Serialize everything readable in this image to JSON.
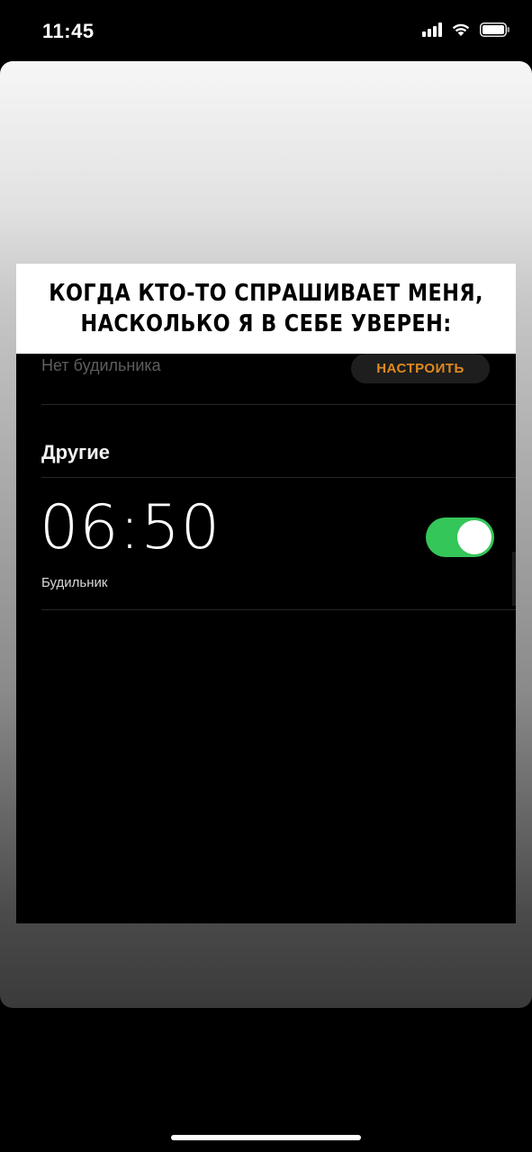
{
  "status_bar": {
    "time": "11:45",
    "icons": [
      "cellular-signal-icon",
      "wifi-icon",
      "battery-icon"
    ]
  },
  "meme": {
    "caption_line1": "КОГДА КТО-ТО СПРАШИВАЕТ МЕНЯ,",
    "caption_line2": "НАСКОЛЬКО Я В СЕБЕ УВЕРЕН:"
  },
  "alarm_screen": {
    "no_alarm_label": "Нет будильника",
    "setup_button_label": "НАСТРОИТЬ",
    "section_header": "Другие",
    "alarm_time": "06:50",
    "alarm_label": "Будильник",
    "toggle_state": "on"
  },
  "colors": {
    "toggle_on": "#35c659",
    "setup_accent": "#e08a1e",
    "background": "#000000"
  }
}
